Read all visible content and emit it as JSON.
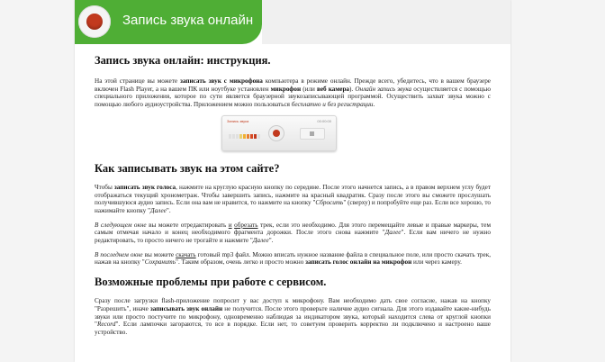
{
  "header": {
    "title": "Запись звука онлайн"
  },
  "widget": {
    "title": "Запись звука",
    "time": "00:00:00",
    "colors": {
      "accent": "#4fae35",
      "record": "#c2391e"
    }
  },
  "sections": {
    "s1": {
      "heading": "Запись звука онлайн: инструкция.",
      "p1": {
        "a": "На этой странице вы можете ",
        "b1": "записать звук с микрофона",
        "c": " компьютера в режиме онлайн. Прежде всего, убедитесь, что в вашем браузере включен Flash Player, а на вашем ПК или ноутбуке установлен ",
        "b2": "микрофон",
        "d": " (или ",
        "b3": "веб камера",
        "e": "). ",
        "i1": "Онлайн запись звука",
        "f": " осуществляется с помощью специального приложения, которое по сути является браузерной звукозаписывающей программой. Осуществить захват звука можно с помощью любого аудиоустройства. Приложением можно пользоваться ",
        "i2": "бесплатно и без регистрации",
        "g": "."
      }
    },
    "s2": {
      "heading": "Как записывать звук на этом сайте?",
      "p1": {
        "a": "Чтобы ",
        "b1": "записать звук голоса",
        "c": ", нажмите на круглую красную кнопку по середине. После этого начнется запись, а в правом верхнем углу будет отображаться текущий хронометраж. Чтобы завершить запись, нажмите на красный квадратик. Сразу после этого вы сможете прослушать получившуюся аудио запись. Если она вам не нравится, то нажмите на кнопку \"",
        "i1": "Сбросить",
        "d": "\" (сверху) и попробуйте еще раз. Если все хорошо, то нажимайте кнопку \"",
        "i2": "Далее",
        "e": "\"."
      },
      "p2": {
        "i1": "В следующем окне",
        "a": " вы можете отредактировать ",
        "u1": "и",
        "b": " ",
        "u2": "обрезать",
        "c": " трек, если это необходимо. Для этого перемещайте левые и правые маркеры, тем самым отмечая начало и конец необходимого фрагмента дорожки. После этого снова нажмите \"",
        "i2": "Далее",
        "d": "\". Если вам ничего не нужно редактировать, то просто ничего не трогайте и нажмите \"",
        "i3": "Далее",
        "e": "\"."
      },
      "p3": {
        "i1": "В последнем окне",
        "a": " вы можете ",
        "u1": "скачать",
        "b": " готовый mp3 файл. Можно вписать нужное название файла в специальное поле, или просто скачать трек, нажав на кнопку \"",
        "i2": "Сохранить",
        "c": "\". Таким образом, очень легко и просто можно ",
        "b1": "записать голос онлайн на микрофон",
        "d": " или через камеру."
      }
    },
    "s3": {
      "heading": "Возможные проблемы при работе с сервисом.",
      "p1": {
        "a": "Сразу после загрузки flash-приложение попросит у вас доступ к микрофону. Вам необходимо дать свое согласие, нажав на кнопку \"Разрешить\", иначе ",
        "b1": "записывать звук онлайн",
        "c": " не получится. После этого проверьте наличие аудио сигнала. Для этого издавайте какие-нибудь звуки или просто постучите по микрофону, одновременно наблюдая за индикатором звука, который находится слева от круглой кнопки \"",
        "i1": "Record",
        "d": "\". Если лампочки загораются, то все в порядке. Если нет, то советуем проверить корректно ли подключено и настроено ваше устройство."
      }
    }
  }
}
